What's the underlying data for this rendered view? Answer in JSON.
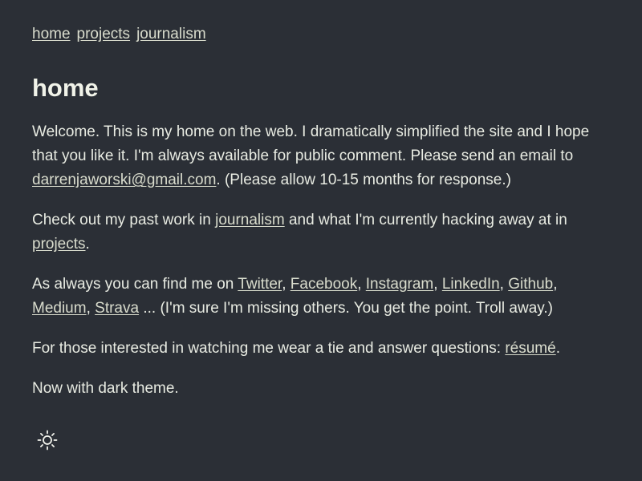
{
  "nav": {
    "home": "home",
    "projects": "projects",
    "journalism": "journalism"
  },
  "page": {
    "title": "home"
  },
  "intro": {
    "text_before": "Welcome. This is my home on the web. I dramatically simplified the site and I hope that you like it. I'm always available for public comment. Please send an email to ",
    "email": "darrenjaworski@gmail.com",
    "text_after": ". (Please allow 10-15 months for response.)"
  },
  "work": {
    "text_1": "Check out my past work in ",
    "journalism_link": "journalism",
    "text_2": " and what I'm currently hacking away at in ",
    "projects_link": "projects",
    "text_3": "."
  },
  "social": {
    "lead": "As always you can find me on ",
    "links": {
      "twitter": "Twitter",
      "facebook": "Facebook",
      "instagram": "Instagram",
      "linkedin": "LinkedIn",
      "github": "Github",
      "medium": "Medium",
      "strava": "Strava"
    },
    "separator": ", ",
    "tail": " ... (I'm sure I'm missing others. You get the point. Troll away.)"
  },
  "resume": {
    "text": "For those interested in watching me wear a tie and answer questions: ",
    "link": "résumé",
    "tail": "."
  },
  "theme": {
    "text": "Now with dark theme.",
    "toggle_icon": "sun-icon"
  }
}
